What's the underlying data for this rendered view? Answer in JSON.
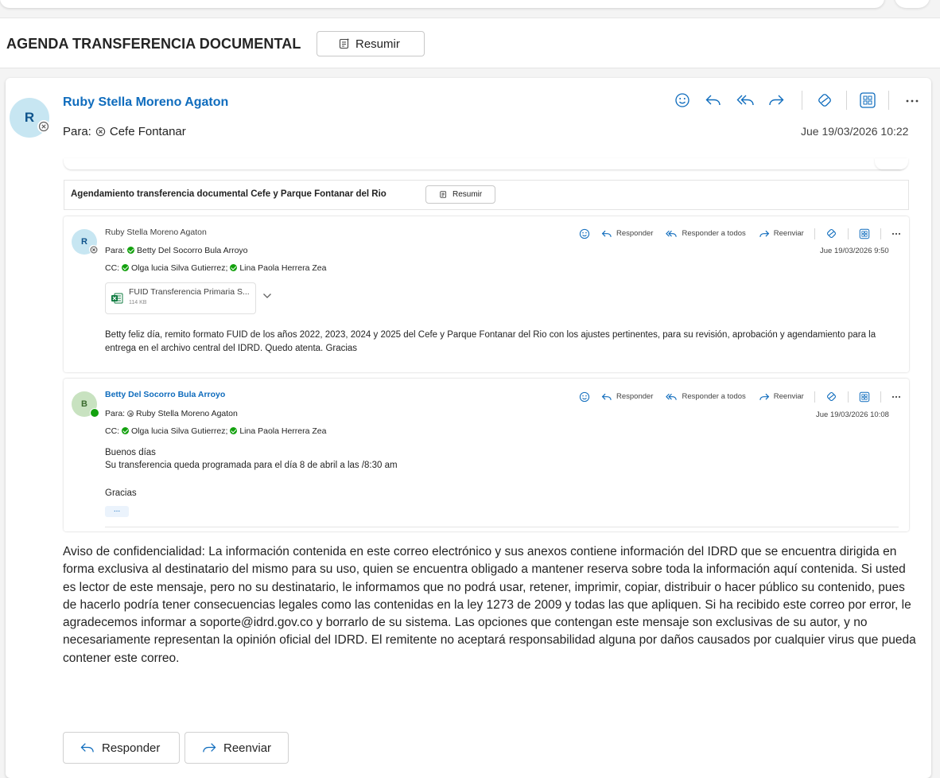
{
  "thread": {
    "subject": "AGENDA TRANSFERENCIA DOCUMENTAL",
    "summarize_label": "Resumir"
  },
  "message": {
    "avatar_initial": "R",
    "sender": "Ruby Stella Moreno Agaton",
    "to_label": "Para:",
    "to_name": "Cefe Fontanar",
    "date": "Jue 19/03/2026 10:22",
    "actions": [
      "emoji-icon",
      "reply-icon",
      "reply-all-icon",
      "forward-icon",
      "sticker-icon",
      "apps-icon",
      "more-icon"
    ]
  },
  "quoted": {
    "subject": "Agendamiento transferencia documental Cefe y Parque Fontanar del Rio",
    "summarize_label": "Resumir",
    "reply_label": "Responder",
    "reply_all_label": "Responder a todos",
    "forward_label": "Reenviar",
    "messages": [
      {
        "avatar_initial": "R",
        "sender": "Ruby Stella Moreno Agaton",
        "to_label": "Para:",
        "to": "Betty Del Socorro Bula Arroyo",
        "cc_label": "CC:",
        "cc": [
          "Olga lucia Silva Gutierrez;",
          "Lina Paola Herrera Zea"
        ],
        "date": "Jue 19/03/2026 9:50",
        "attachment": {
          "name": "FUID Transferencia Primaria S...",
          "size": "114 KB"
        },
        "body": "Betty feliz día, remito formato FUID de los años 2022, 2023, 2024 y 2025 del Cefe y Parque Fontanar del Rio con los ajustes pertinentes, para su revisión, aprobación y agendamiento para la entrega en el archivo central del IDRD. Quedo atenta. Gracias"
      },
      {
        "avatar_initial": "B",
        "sender": "Betty Del Socorro Bula Arroyo",
        "to_label": "Para:",
        "to": "Ruby Stella Moreno Agaton",
        "cc_label": "CC:",
        "cc": [
          "Olga lucia Silva Gutierrez;",
          "Lina Paola Herrera Zea"
        ],
        "date": "Jue 19/03/2026 10:08",
        "body_lines": [
          "Buenos días",
          "Su transferencia queda programada para el día 8 de abril a las /8:30 am",
          "Gracias"
        ],
        "ellipsis": "..."
      }
    ]
  },
  "disclaimer": "Aviso de confidencialidad: La información contenida en este correo electrónico y sus anexos contiene información del IDRD que se encuentra dirigida en forma exclusiva al destinatario del mismo para su uso, quien se encuentra obligado a mantener reserva sobre toda la información aquí contenida. Si usted es lector de este mensaje, pero no su destinatario, le informamos que no podrá usar, retener, imprimir, copiar, distribuir o hacer público su contenido, pues de hacerlo podría tener consecuencias legales como las contenidas en la ley 1273 de 2009 y todas las que apliquen. Si ha recibido este correo por error, le agradecemos informar a soporte@idrd.gov.co y borrarlo de su sistema. Las opciones que contengan este mensaje son exclusivas de su autor, y no necesariamente representan la opinión oficial del IDRD. El remitente no aceptará responsabilidad alguna por daños causados por cualquier virus que pueda contener este correo.",
  "footer": {
    "reply_label": "Responder",
    "forward_label": "Reenviar"
  },
  "colors": {
    "accent": "#0f6cbd",
    "avatar_r_bg": "#c7e6f2",
    "avatar_b_bg": "#c8e2c0",
    "presence_ok": "#13a10e"
  }
}
